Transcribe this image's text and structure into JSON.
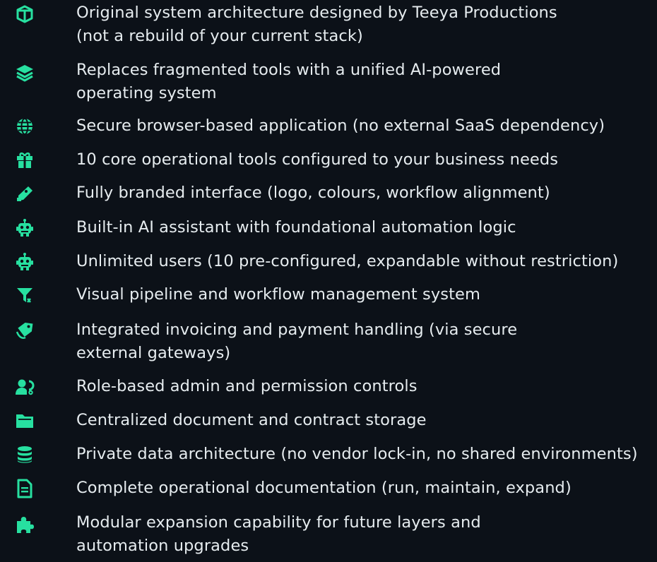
{
  "accent_color": "#27e0a0",
  "text_color": "#e6ecef",
  "background_color": "#0c1118",
  "items": [
    {
      "icon": "box-icon",
      "lines": [
        "Original system architecture designed by Teeya Productions",
        "(not a rebuild of your current stack)"
      ]
    },
    {
      "icon": "layers-icon",
      "lines": [
        "Replaces fragmented tools with a unified AI-powered",
        "operating system"
      ]
    },
    {
      "icon": "globe-icon",
      "lines": [
        "Secure browser-based application (no external SaaS dependency)"
      ]
    },
    {
      "icon": "gift-icon",
      "lines": [
        "10 core operational tools configured to your business needs"
      ]
    },
    {
      "icon": "pen-icon",
      "lines": [
        "Fully branded interface (logo, colours, workflow alignment)"
      ]
    },
    {
      "icon": "robot-icon",
      "lines": [
        "Built-in AI assistant with foundational automation logic"
      ]
    },
    {
      "icon": "robot-icon",
      "lines": [
        "Unlimited users (10 pre-configured, expandable without restriction)"
      ]
    },
    {
      "icon": "filter-icon",
      "lines": [
        "Visual pipeline and workflow management system"
      ]
    },
    {
      "icon": "tag-icon",
      "lines": [
        "Integrated invoicing and payment handling (via secure",
        "external gateways)"
      ]
    },
    {
      "icon": "user-settings-icon",
      "lines": [
        "Role-based admin and permission controls"
      ]
    },
    {
      "icon": "folder-icon",
      "lines": [
        "Centralized document and contract storage"
      ]
    },
    {
      "icon": "database-icon",
      "lines": [
        "Private data architecture (no vendor lock-in, no shared environments)"
      ]
    },
    {
      "icon": "document-icon",
      "lines": [
        "Complete operational documentation (run, maintain, expand)"
      ]
    },
    {
      "icon": "puzzle-icon",
      "lines": [
        "Modular expansion capability for future layers and",
        "automation upgrades"
      ]
    }
  ]
}
